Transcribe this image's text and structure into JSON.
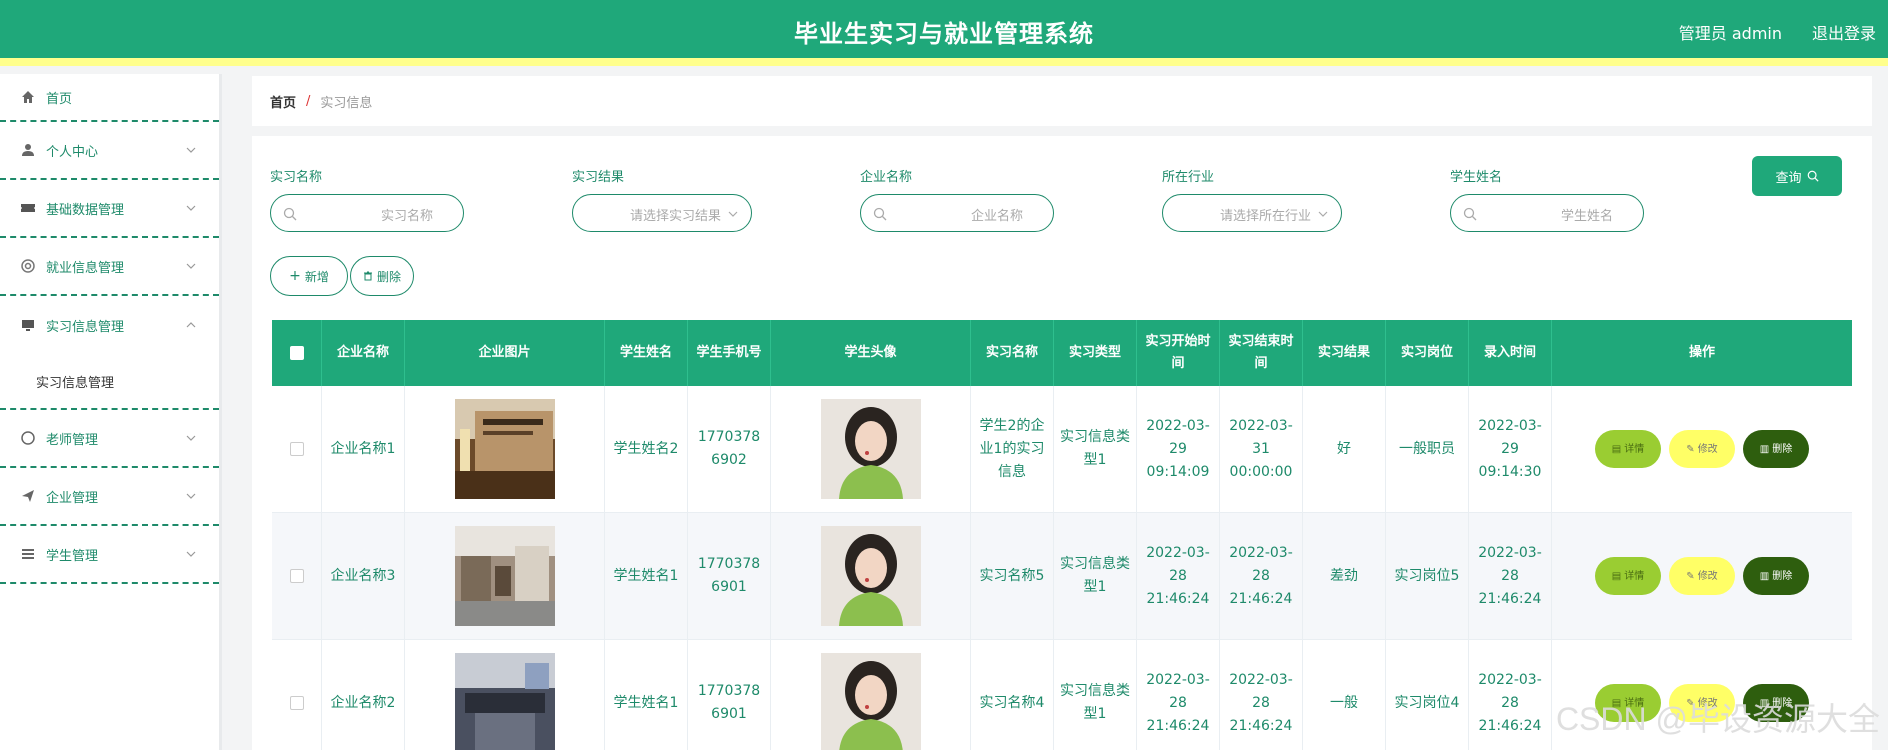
{
  "header": {
    "title": "毕业生实习与就业管理系统",
    "user": "管理员 admin",
    "logout": "退出登录",
    "accent": "#1fa87a"
  },
  "sidebar": {
    "items": [
      {
        "label": "首页",
        "icon": "home-icon"
      },
      {
        "label": "个人中心",
        "icon": "user-icon"
      },
      {
        "label": "基础数据管理",
        "icon": "ticket-icon"
      },
      {
        "label": "就业信息管理",
        "icon": "lifebuoy-icon"
      },
      {
        "label": "实习信息管理",
        "icon": "monitor-icon"
      },
      {
        "label": "老师管理",
        "icon": "compass-icon"
      },
      {
        "label": "企业管理",
        "icon": "send-icon"
      },
      {
        "label": "学生管理",
        "icon": "list-icon"
      }
    ],
    "submenu_active": "实习信息管理"
  },
  "breadcrumb": {
    "home": "首页",
    "sep": "/",
    "current": "实习信息"
  },
  "filters": [
    {
      "label": "实习名称",
      "placeholder": "实习名称"
    },
    {
      "label": "实习结果",
      "placeholder": "请选择实习结果"
    },
    {
      "label": "企业名称",
      "placeholder": "企业名称"
    },
    {
      "label": "所在行业",
      "placeholder": "请选择所在行业"
    },
    {
      "label": "学生姓名",
      "placeholder": "学生姓名"
    }
  ],
  "buttons": {
    "query": "查询",
    "add": "新增",
    "delete": "删除"
  },
  "table": {
    "headers": [
      "企业名称",
      "企业图片",
      "学生姓名",
      "学生手机号",
      "学生头像",
      "实习名称",
      "实习类型",
      "实习开始时间",
      "实习结束时间",
      "实习结果",
      "实习岗位",
      "录入时间",
      "操作"
    ],
    "rows": [
      {
        "company": "企业名称1",
        "student": "学生姓名2",
        "phone": "17703786902",
        "name": "学生2的企业1的实习信息",
        "type": "实习信息类型1",
        "start": "2022-03-29 09:14:09",
        "end": "2022-03-31 00:00:00",
        "result": "好",
        "post": "一般职员",
        "entry": "2022-03-29 09:14:30"
      },
      {
        "company": "企业名称3",
        "student": "学生姓名1",
        "phone": "17703786901",
        "name": "实习名称5",
        "type": "实习信息类型1",
        "start": "2022-03-28 21:46:24",
        "end": "2022-03-28 21:46:24",
        "result": "差劲",
        "post": "实习岗位5",
        "entry": "2022-03-28 21:46:24"
      },
      {
        "company": "企业名称2",
        "student": "学生姓名1",
        "phone": "17703786901",
        "name": "实习名称4",
        "type": "实习信息类型1",
        "start": "2022-03-28 21:46:24",
        "end": "2022-03-28 21:46:24",
        "result": "一般",
        "post": "实习岗位4",
        "entry": "2022-03-28 21:46:24"
      }
    ],
    "actions": {
      "detail": "详情",
      "edit": "修改",
      "delete": "删除"
    }
  },
  "watermark": "CSDN @毕设资源大全"
}
